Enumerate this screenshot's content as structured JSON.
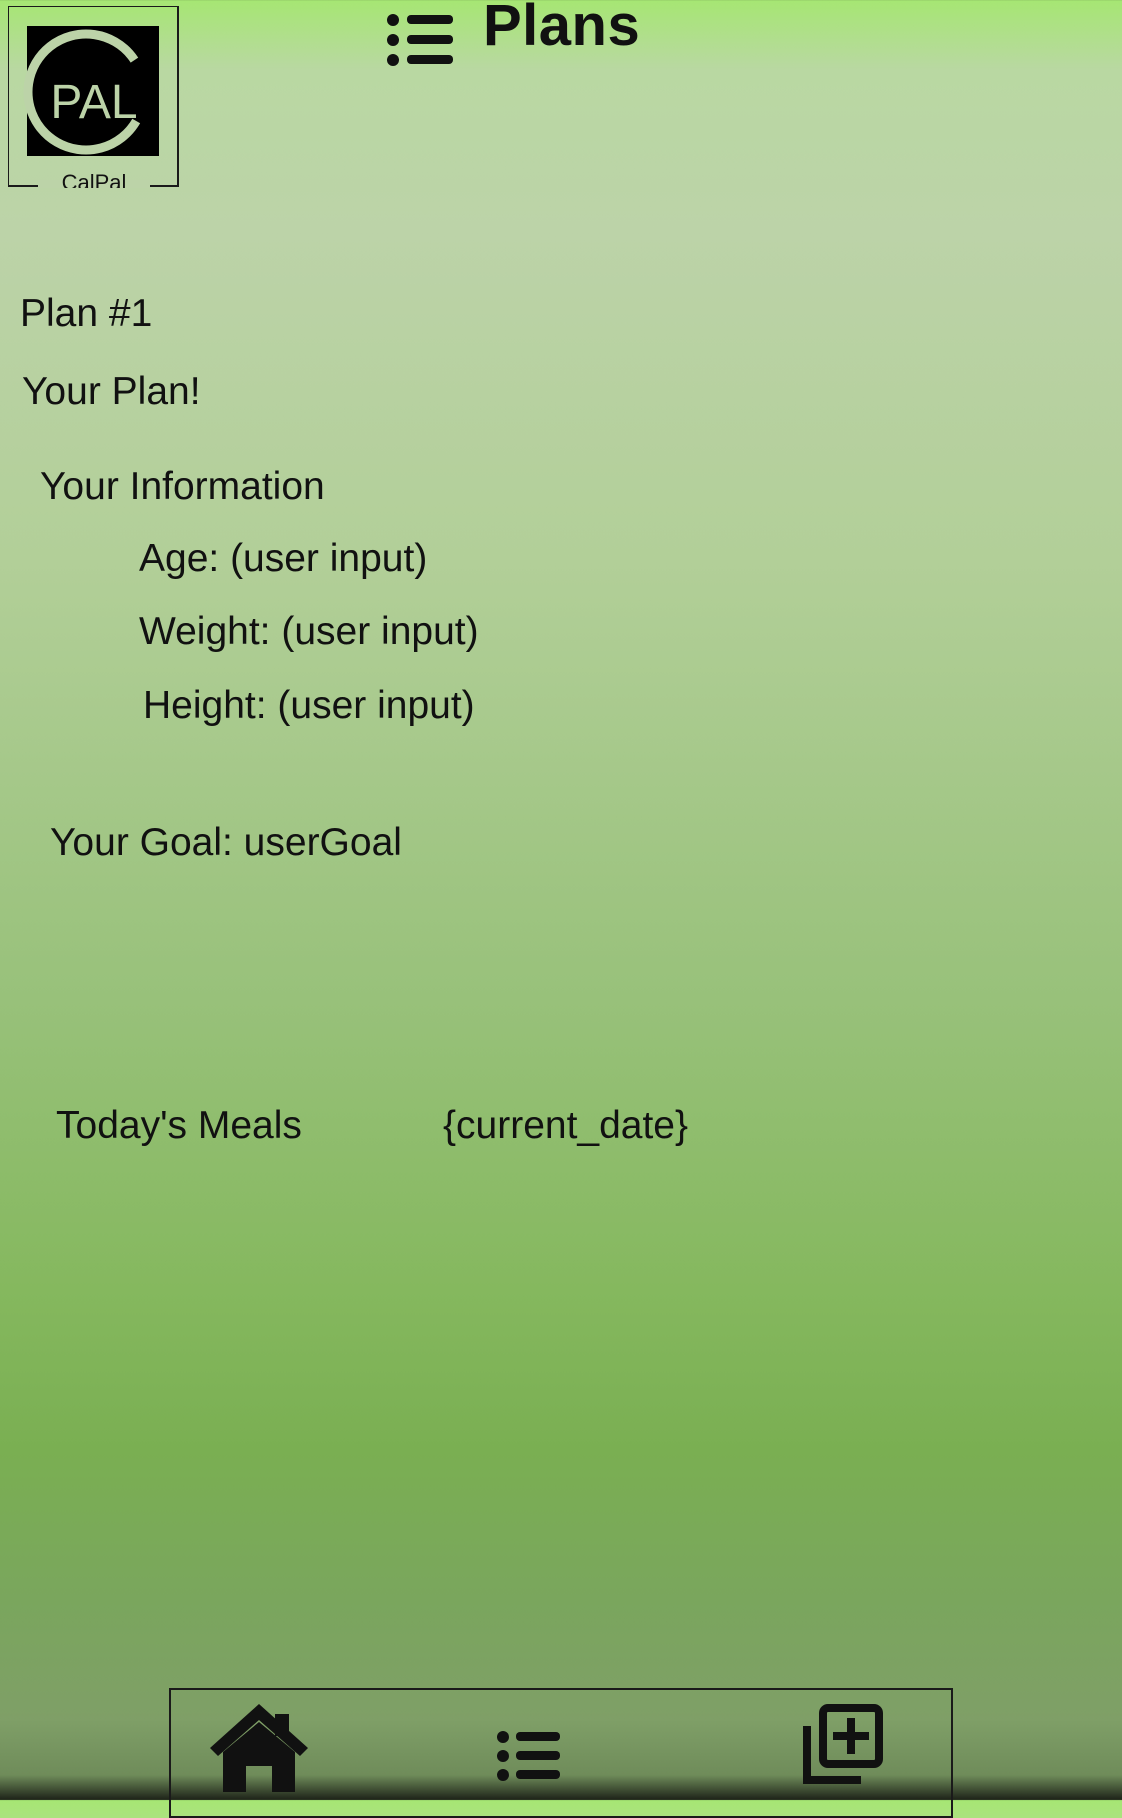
{
  "app": {
    "logo_text": "PAL",
    "logo_caption": "CalPal"
  },
  "header": {
    "title": "Plans",
    "menu_icon": "list-icon"
  },
  "plan": {
    "number_label": "Plan #1",
    "heading": "Your Plan!",
    "info_heading": "Your Information",
    "age": "Age: (user input)",
    "weight": "Weight: (user input)",
    "height": "Height: (user input)",
    "goal": "Your Goal: userGoal"
  },
  "meals": {
    "label": "Today's Meals",
    "date": "{current_date}"
  },
  "bottom_nav": {
    "items": [
      {
        "icon": "home-icon"
      },
      {
        "icon": "list-icon"
      },
      {
        "icon": "add-box-icon"
      }
    ]
  },
  "colors": {
    "gradient_top": "#a6e673",
    "gradient_mid": "#b9d8a2",
    "gradient_bottom": "#7aaf52",
    "text": "#111111"
  }
}
